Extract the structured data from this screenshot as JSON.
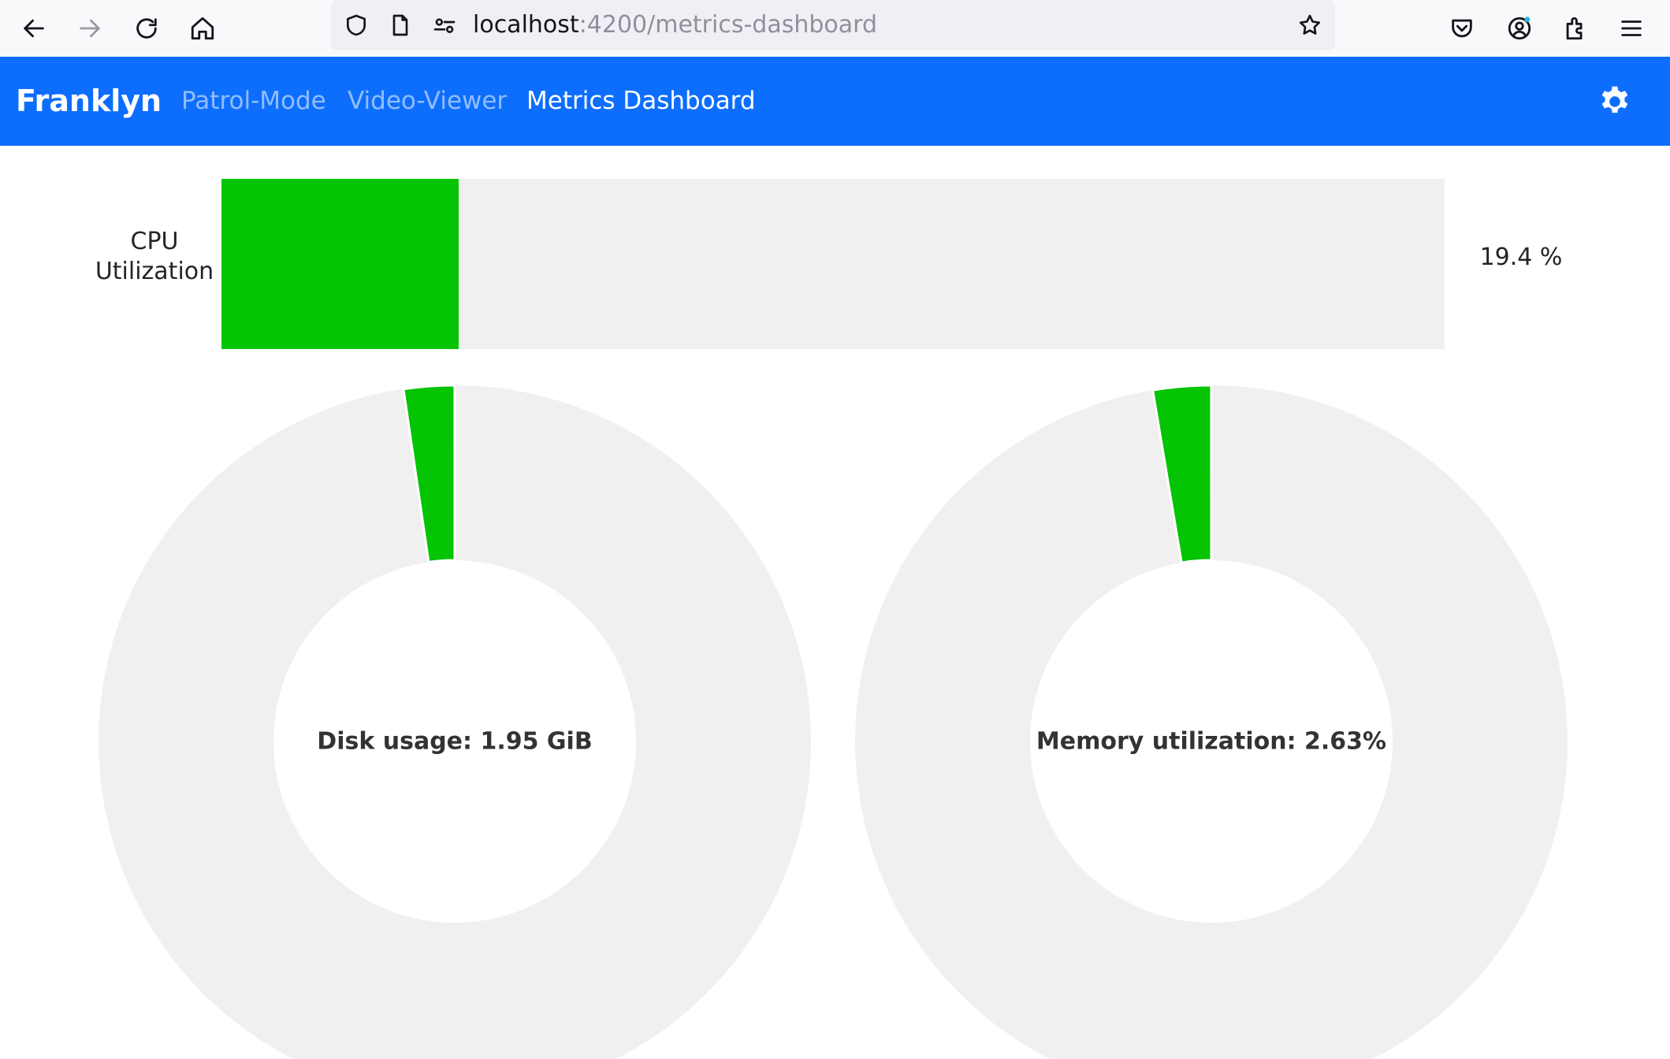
{
  "browser": {
    "url_host": "localhost",
    "url_path": ":4200/metrics-dashboard",
    "icons": {
      "back": "back-arrow-icon",
      "forward": "forward-arrow-icon",
      "reload": "reload-icon",
      "home": "home-icon",
      "shield": "tracking-shield-icon",
      "page": "page-icon",
      "permissions": "permissions-icon",
      "bookmark": "bookmark-star-icon",
      "pocket": "pocket-icon",
      "account": "account-icon",
      "extensions": "extensions-icon",
      "menu": "hamburger-menu-icon"
    }
  },
  "navbar": {
    "brand": "Franklyn",
    "links": [
      {
        "label": "Patrol-Mode",
        "active": false
      },
      {
        "label": "Video-Viewer",
        "active": false
      },
      {
        "label": "Metrics Dashboard",
        "active": true
      }
    ],
    "settings_icon": "gear-icon",
    "color": "#0d6efd"
  },
  "cpu": {
    "label": "CPU Utilization",
    "value_text": "19.4 %",
    "percent": 19.4,
    "fill_color": "#04c404",
    "track_color": "#f0f0f0"
  },
  "chart_data": [
    {
      "type": "pie",
      "variant": "donut",
      "center_label": "Disk usage: 1.95 GiB",
      "slices": [
        {
          "label": "used",
          "fraction": 0.023,
          "color": "#04c404"
        },
        {
          "label": "free",
          "fraction": 0.977,
          "color": "#f0f0f0"
        }
      ]
    },
    {
      "type": "pie",
      "variant": "donut",
      "center_label": "Memory utilization: 2.63%",
      "slices": [
        {
          "label": "used",
          "fraction": 0.0263,
          "color": "#04c404"
        },
        {
          "label": "free",
          "fraction": 0.9737,
          "color": "#f0f0f0"
        }
      ]
    }
  ]
}
